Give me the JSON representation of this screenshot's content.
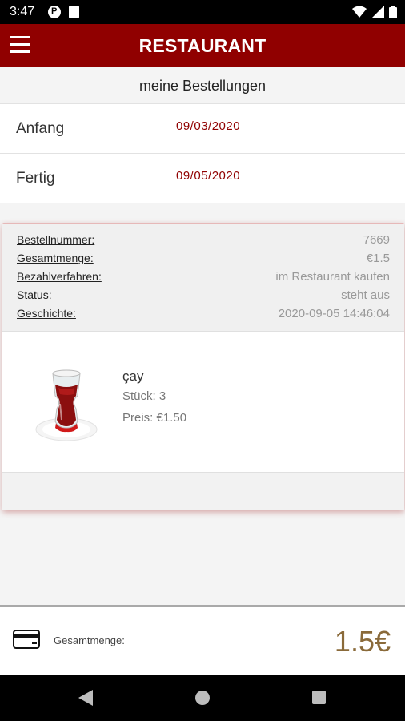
{
  "status_bar": {
    "time": "3:47",
    "icons": [
      "p-notification-icon",
      "sd-card-icon",
      "wifi-icon",
      "signal-icon",
      "battery-icon"
    ]
  },
  "app_bar": {
    "title": "RESTAURANT",
    "menu_icon": "hamburger-menu-icon"
  },
  "page": {
    "subtitle": "meine Bestellungen"
  },
  "date_filter": {
    "start_label": "Anfang",
    "start_value": "09/03/2020",
    "end_label": "Fertig",
    "end_value": "09/05/2020"
  },
  "order": {
    "fields": [
      {
        "label": "Bestellnummer:",
        "value": "7669"
      },
      {
        "label": "Gesamtmenge:",
        "value": "€1.5"
      },
      {
        "label": "Bezahlverfahren:",
        "value": "im Restaurant kaufen"
      },
      {
        "label": "Status:",
        "value": "steht aus"
      },
      {
        "label": "Geschichte:",
        "value": "2020-09-05 14:46:04"
      }
    ],
    "items": [
      {
        "name": "çay",
        "quantity": "Stück: 3",
        "price": "Preis: €1.50",
        "image": "turkish-tea-glass"
      }
    ]
  },
  "footer": {
    "icon": "credit-card-icon",
    "total_label": "Gesamtmenge:",
    "total_value": "1.5€"
  },
  "nav_bar": {
    "icons": [
      "back-icon",
      "home-icon",
      "recents-icon"
    ]
  },
  "colors": {
    "primary": "#900000",
    "date_text": "#900000",
    "total_amount": "#8a6a3a"
  }
}
